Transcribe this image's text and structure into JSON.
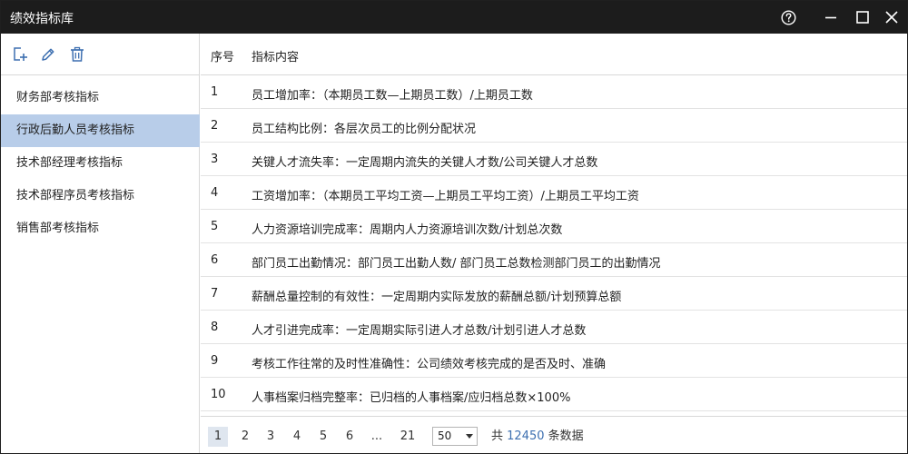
{
  "window": {
    "title": "绩效指标库"
  },
  "sidebar": {
    "tools": [
      "add-icon",
      "edit-icon",
      "delete-icon"
    ],
    "items": [
      {
        "label": "财务部考核指标"
      },
      {
        "label": "行政后勤人员考核指标"
      },
      {
        "label": "技术部经理考核指标"
      },
      {
        "label": "技术部程序员考核指标"
      },
      {
        "label": "销售部考核指标"
      }
    ],
    "active_index": 1
  },
  "table": {
    "headers": {
      "index": "序号",
      "content": "指标内容"
    },
    "rows": [
      {
        "index": "1",
        "content": "员工增加率：（本期员工数—上期员工数）/上期员工数"
      },
      {
        "index": "2",
        "content": "员工结构比例：各层次员工的比例分配状况"
      },
      {
        "index": "3",
        "content": "关键人才流失率：一定周期内流失的关键人才数/公司关键人才总数"
      },
      {
        "index": "4",
        "content": "工资增加率：（本期员工平均工资—上期员工平均工资）/上期员工平均工资"
      },
      {
        "index": "5",
        "content": "人力资源培训完成率：周期内人力资源培训次数/计划总次数"
      },
      {
        "index": "6",
        "content": "部门员工出勤情况：部门员工出勤人数/ 部门员工总数检测部门员工的出勤情况"
      },
      {
        "index": "7",
        "content": "薪酬总量控制的有效性：一定周期内实际发放的薪酬总额/计划预算总额"
      },
      {
        "index": "8",
        "content": "人才引进完成率：一定周期实际引进人才总数/计划引进人才总数"
      },
      {
        "index": "9",
        "content": "考核工作往常的及时性准确性：公司绩效考核完成的是否及时、准确"
      },
      {
        "index": "10",
        "content": "人事档案归档完整率：已归档的人事档案/应归档总数×100%"
      }
    ]
  },
  "pager": {
    "pages": [
      "1",
      "2",
      "3",
      "4",
      "5",
      "6",
      "...",
      "21"
    ],
    "current_page": "1",
    "page_size": "50",
    "total_prefix": "共",
    "total_count": "12450",
    "total_suffix": "条数据"
  },
  "colors": {
    "titlebar": "#1c1c1c",
    "selected_item": "#b8cde9",
    "accent_number": "#3d6fb0"
  }
}
